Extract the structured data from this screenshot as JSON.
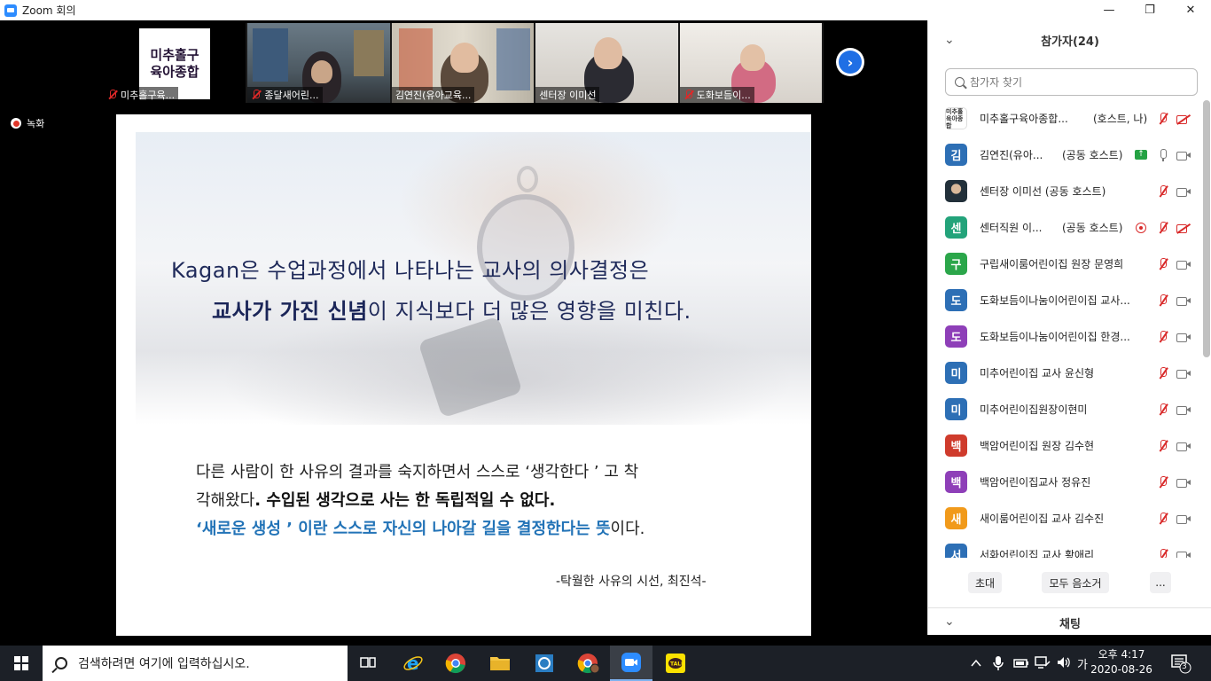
{
  "window": {
    "title": "Zoom 회의",
    "minimize": "—",
    "maximize": "❐",
    "close": "✕"
  },
  "thumbnails": [
    {
      "logo_line1": "미추홀구",
      "logo_line2": "육아종합",
      "label": "미추홀구육...",
      "muted": true
    },
    {
      "label": "종달새어린...",
      "muted": true
    },
    {
      "label": "김연진(유아교육...",
      "muted": false,
      "active": true
    },
    {
      "label": "센터장 이미선",
      "muted": false
    },
    {
      "label": "도화보듬이...",
      "muted": true
    }
  ],
  "recording_label": "녹화",
  "slide": {
    "line1": "Kagan은 수업과정에서 나타나는 교사의  의사결정은",
    "line2_bold": "교사가 가진 신념",
    "line2_rest": "이 지식보다 더 많은 영향을 미친다.",
    "quote1": "다른 사람이 한 사유의 결과를 숙지하면서 스스로 ‘생각한다 ’ 고 착",
    "quote2_plain": "각해왔다",
    "quote2_bold": ". 수입된 생각으로 사는 한 독립적일 수 없다.",
    "quote3_blue": "‘새로운 생성 ’ 이란 스스로 자신의 나아갈 길을 결정한다는 뜻",
    "quote3_rest": "이다.",
    "source": "-탁월한 사유의 시선, 최진석-"
  },
  "panel": {
    "title": "참가자(24)",
    "search_placeholder": "참가자 찾기",
    "participants": [
      {
        "avatar": "미추홀육아종합",
        "avatar_type": "image",
        "name": "미추홀구육아종합...",
        "role": "(호스트, 나)",
        "mic": "muted",
        "cam": "off"
      },
      {
        "avatar": "김",
        "color": "#2d6fb5",
        "name": "김연진(유아...",
        "role": "(공동 호스트)",
        "share": true,
        "mic": "on",
        "cam": "on"
      },
      {
        "avatar": "",
        "avatar_type": "photo",
        "name": "센터장 이미선 (공동 호스트)",
        "role": "",
        "mic": "muted",
        "cam": "on"
      },
      {
        "avatar": "센",
        "color": "#23a37a",
        "name": "센터직원 이...",
        "role": "(공동 호스트)",
        "recording": true,
        "mic": "muted",
        "cam": "off"
      },
      {
        "avatar": "구",
        "color": "#2ba64a",
        "name": "구립새이룸어린이집 원장 문영희",
        "role": "",
        "mic": "muted",
        "cam": "on"
      },
      {
        "avatar": "도",
        "color": "#2d6fb5",
        "name": "도화보듬이나눔이어린이집 교사...",
        "role": "",
        "mic": "muted",
        "cam": "on"
      },
      {
        "avatar": "도",
        "color": "#8e3fb8",
        "name": "도화보듬이나눔이어린이집 한경...",
        "role": "",
        "mic": "muted",
        "cam": "on"
      },
      {
        "avatar": "미",
        "color": "#2d6fb5",
        "name": "미추어린이집 교사 윤신형",
        "role": "",
        "mic": "muted",
        "cam": "on"
      },
      {
        "avatar": "미",
        "color": "#2d6fb5",
        "name": "미추어린이집원장이현미",
        "role": "",
        "mic": "muted",
        "cam": "on"
      },
      {
        "avatar": "백",
        "color": "#cf3b2c",
        "name": "백암어린이집 원장 김수현",
        "role": "",
        "mic": "muted",
        "cam": "on"
      },
      {
        "avatar": "백",
        "color": "#8e3fb8",
        "name": "백암어린이집교사 정유진",
        "role": "",
        "mic": "muted",
        "cam": "on"
      },
      {
        "avatar": "새",
        "color": "#f19a1b",
        "name": "새이룸어린이집 교사 김수진",
        "role": "",
        "mic": "muted",
        "cam": "on"
      },
      {
        "avatar": "서",
        "color": "#2d6fb5",
        "name": "서화어린이집 교사 황애리",
        "role": "",
        "mic": "muted",
        "cam": "on"
      }
    ],
    "invite_label": "초대",
    "mute_all_label": "모두 음소거",
    "more_label": "...",
    "chat_title": "채팅"
  },
  "taskbar": {
    "search_placeholder": "검색하려면 여기에 입력하십시오.",
    "ime": "가",
    "time": "오후 4:17",
    "date": "2020-08-26",
    "notif_count": "3"
  }
}
